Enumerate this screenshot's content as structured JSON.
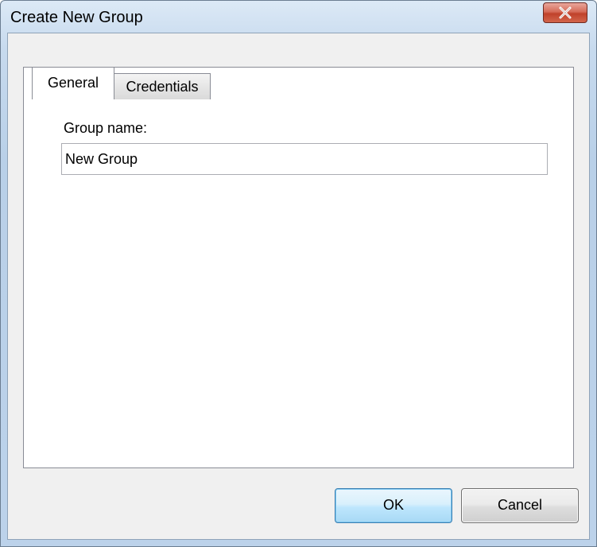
{
  "window": {
    "title": "Create New Group",
    "close_glyph": "X"
  },
  "tabs": [
    {
      "label": "General",
      "selected": true
    },
    {
      "label": "Credentials",
      "selected": false
    }
  ],
  "general": {
    "group_name_label": "Group name:",
    "group_name_value": "New Group"
  },
  "buttons": {
    "ok_label": "OK",
    "cancel_label": "Cancel"
  },
  "icons": {
    "close": "close-icon"
  },
  "colors": {
    "close_button": "#c0422b",
    "default_button_border": "#3c7fb1"
  }
}
